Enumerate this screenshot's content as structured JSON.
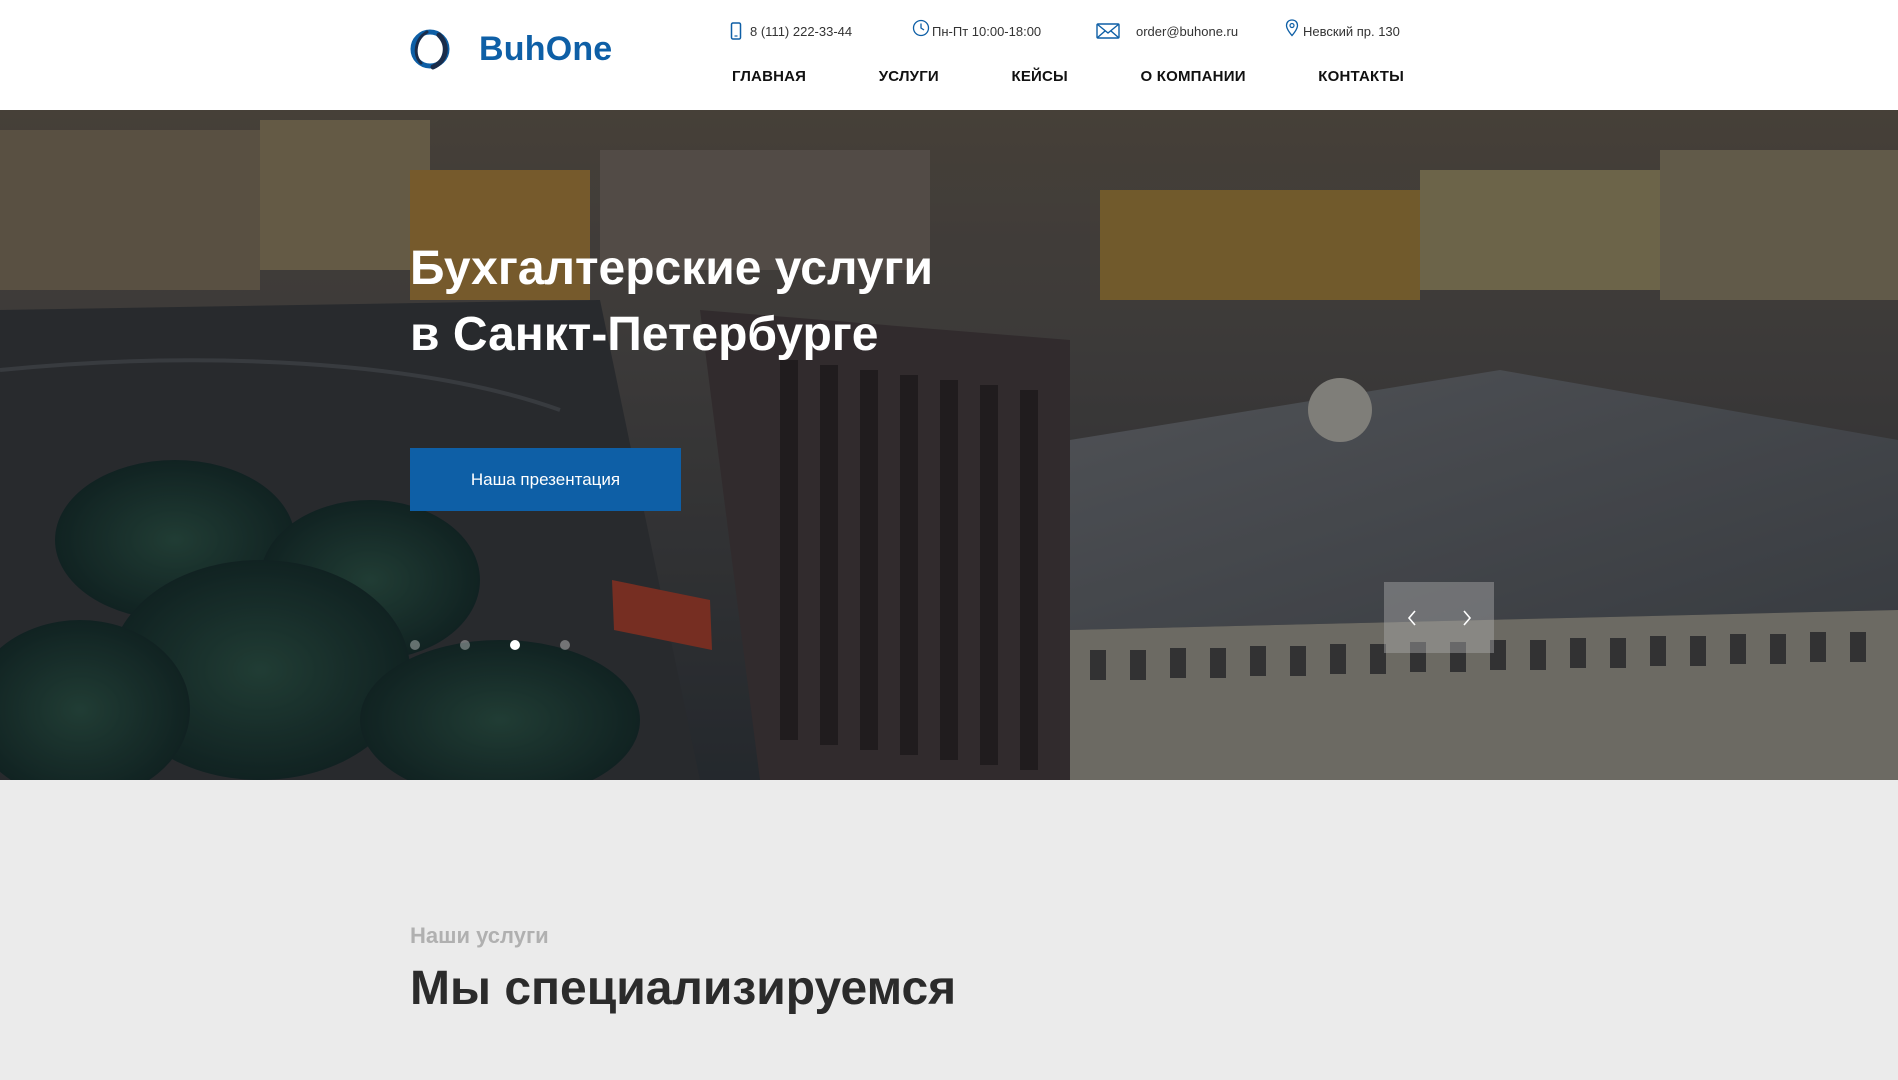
{
  "brand": {
    "name": "BuhOne",
    "color": "#0e5fa6"
  },
  "contacts": {
    "phone": "8 (111) 222-33-44",
    "hours": "Пн-Пт 10:00-18:00",
    "email": "order@buhone.ru",
    "address": "Невский пр. 130"
  },
  "nav": {
    "items": [
      {
        "label": "ГЛАВНАЯ"
      },
      {
        "label": "УСЛУГИ"
      },
      {
        "label": "КЕЙСЫ"
      },
      {
        "label": "О КОМПАНИИ"
      },
      {
        "label": "КОНТАКТЫ"
      }
    ]
  },
  "hero": {
    "title_line1": "Бухгалтерские услуги",
    "title_line2": "в Санкт-Петербурге",
    "button_label": "Наша презентация",
    "slides_count": 4,
    "active_slide": 3
  },
  "services": {
    "subtitle": "Наши услуги",
    "title": "Мы специализируемся"
  },
  "icons": {
    "phone": "phone-icon",
    "clock": "clock-icon",
    "mail": "mail-icon",
    "location": "location-pin-icon",
    "prev": "chevron-left-icon",
    "next": "chevron-right-icon"
  }
}
